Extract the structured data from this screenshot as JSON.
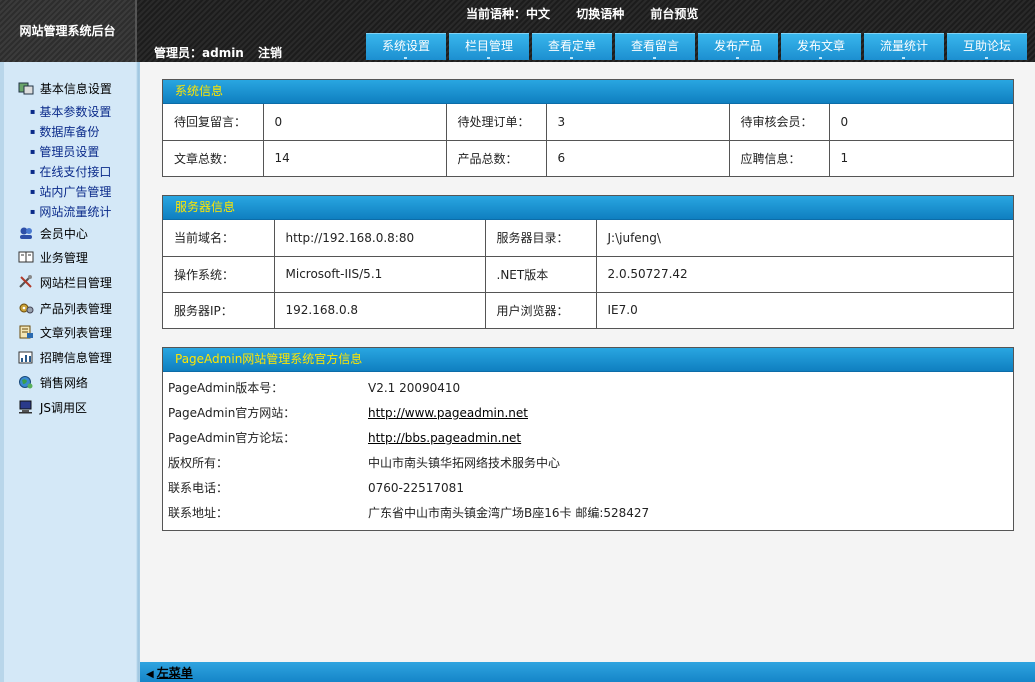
{
  "brand": {
    "title": "网站管理系统后台"
  },
  "lang_bar": {
    "current_label": "当前语种：中文",
    "switch_label": "切换语种",
    "preview_label": "前台预览"
  },
  "admin": {
    "label": "管理员：admin",
    "logout": "注销"
  },
  "nav": {
    "tabs": [
      "系统设置",
      "栏目管理",
      "查看定单",
      "查看留言",
      "发布产品",
      "发布文章",
      "流量统计",
      "互助论坛"
    ]
  },
  "sidebar": {
    "sections": [
      {
        "label": "基本信息设置",
        "icon": "settings-icon",
        "color": "#3a7a3a"
      },
      {
        "label": "会员中心",
        "icon": "members-icon",
        "color": "#2d4fa8"
      },
      {
        "label": "业务管理",
        "icon": "book-icon",
        "color": "#5a4a2a"
      },
      {
        "label": "网站栏目管理",
        "icon": "tools-icon",
        "color": "#b03a2a"
      },
      {
        "label": "产品列表管理",
        "icon": "gear-icon",
        "color": "#7a5a1a"
      },
      {
        "label": "文章列表管理",
        "icon": "document-icon",
        "color": "#7a5a1a"
      },
      {
        "label": "招聘信息管理",
        "icon": "chart-icon",
        "color": "#2a5a8a"
      },
      {
        "label": "销售网络",
        "icon": "globe-icon",
        "color": "#2a7a3a"
      },
      {
        "label": "JS调用区",
        "icon": "monitor-icon",
        "color": "#2a3a8a"
      }
    ],
    "subitems": [
      "基本参数设置",
      "数据库备份",
      "管理员设置",
      "在线支付接口",
      "站内广告管理",
      "网站流量统计"
    ]
  },
  "panels": {
    "system": {
      "title": "系统信息",
      "rows": [
        [
          "待回复留言：",
          "0",
          "待处理订单：",
          "3",
          "待审核会员：",
          "0"
        ],
        [
          "文章总数：",
          "14",
          "产品总数：",
          "6",
          "应聘信息：",
          "1"
        ]
      ]
    },
    "server": {
      "title": "服务器信息",
      "rows": [
        [
          "当前域名：",
          "http://192.168.0.8:80",
          "服务器目录：",
          "J:\\jufeng\\"
        ],
        [
          "操作系统：",
          "Microsoft-IIS/5.1",
          ".NET版本",
          "2.0.50727.42"
        ],
        [
          "服务器IP：",
          "192.168.0.8",
          "用户浏览器：",
          "IE7.0"
        ]
      ]
    },
    "official": {
      "title": "PageAdmin网站管理系统官方信息",
      "rows": [
        {
          "k": "PageAdmin版本号：",
          "v": "V2.1 20090410"
        },
        {
          "k": "PageAdmin官方网站：",
          "v": "http://www.pageadmin.net"
        },
        {
          "k": "PageAdmin官方论坛：",
          "v": "http://bbs.pageadmin.net"
        },
        {
          "k": "版权所有：",
          "v": "中山市南头镇华拓网络技术服务中心"
        },
        {
          "k": "联系电话：",
          "v": "0760-22517081"
        },
        {
          "k": "联系地址：",
          "v": "广东省中山市南头镇金湾广场B座16卡 邮编:528427"
        }
      ]
    }
  },
  "bottombar": {
    "toggle_label": "左菜单"
  }
}
